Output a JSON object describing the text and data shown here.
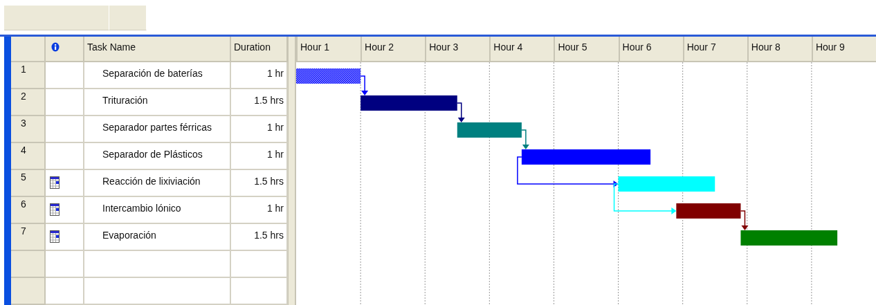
{
  "table": {
    "columns": {
      "task_name": "Task Name",
      "duration": "Duration"
    },
    "rows": [
      {
        "id": "1",
        "name": "Separación de baterías",
        "duration": "1 hr",
        "indicator": false,
        "kind": "hatched",
        "color": "#0000ff"
      },
      {
        "id": "2",
        "name": "Trituración",
        "duration": "1.5 hrs",
        "indicator": false,
        "kind": "solid",
        "color": "#000080"
      },
      {
        "id": "3",
        "name": "Separador partes férricas",
        "duration": "1 hr",
        "indicator": false,
        "kind": "solid",
        "color": "#008080"
      },
      {
        "id": "4",
        "name": "Separador de Plásticos",
        "duration": "1 hr",
        "indicator": false,
        "kind": "solid",
        "color": "#0000ff"
      },
      {
        "id": "5",
        "name": "Reacción de lixiviación",
        "duration": "1.5 hrs",
        "indicator": true,
        "kind": "solid",
        "color": "#00ffff"
      },
      {
        "id": "6",
        "name": "Intercambio lónico",
        "duration": "1 hr",
        "indicator": true,
        "kind": "solid",
        "color": "#800000"
      },
      {
        "id": "7",
        "name": "Evaporación",
        "duration": "1.5 hrs",
        "indicator": true,
        "kind": "solid",
        "color": "#008000"
      }
    ]
  },
  "gantt": {
    "timescale": [
      "Hour 1",
      "Hour 2",
      "Hour 3",
      "Hour 4",
      "Hour 5",
      "Hour 6",
      "Hour 7",
      "Hour 8",
      "Hour 9"
    ]
  }
}
